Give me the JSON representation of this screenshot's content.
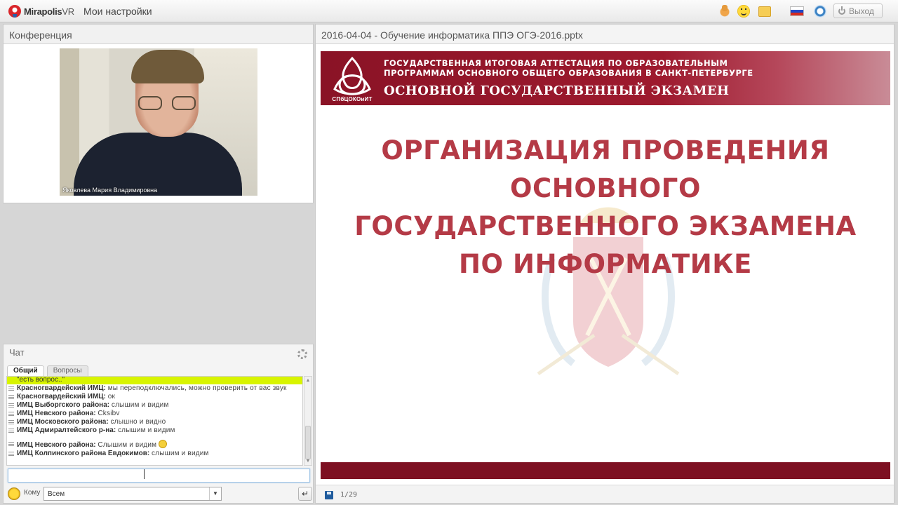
{
  "app": {
    "logo_main": "Mirapolis",
    "logo_suffix": "VR",
    "nav_settings": "Мои настройки",
    "exit_label": "Выход",
    "icons": [
      "hand-icon",
      "smile-icon",
      "folder-icon",
      "russian-flag-icon",
      "help-icon",
      "power-icon"
    ]
  },
  "conference": {
    "title": "Конференция",
    "participant_name": "Яковлева Мария Владимировна"
  },
  "presentation": {
    "file_title": "2016-04-04 - Обучение информатика ППЭ ОГЭ-2016.pptx",
    "page_indicator": "1/29",
    "slide": {
      "banner_line1": "ГОСУДАРСТВЕННАЯ ИТОГОВАЯ АТТЕСТАЦИЯ ПО ОБРАЗОВАТЕЛЬНЫМ",
      "banner_line2": "ПРОГРАММАМ ОСНОВНОГО ОБЩЕГО ОБРАЗОВАНИЯ В САНКТ-ПЕТЕРБУРГЕ",
      "banner_line3": "ОСНОВНОЙ ГОСУДАРСТВЕННЫЙ ЭКЗАМЕН",
      "emblem_label": "СПбЦОКОиИТ",
      "title_lines": [
        "ОРГАНИЗАЦИЯ ПРОВЕДЕНИЯ",
        "ОСНОВНОГО",
        "ГОСУДАРСТВЕННОГО ЭКЗАМЕНА",
        "ПО ИНФОРМАТИКЕ"
      ],
      "colors": {
        "banner": "#9e1a2e",
        "title": "#b43a46",
        "footer": "#7d1022"
      }
    }
  },
  "chat": {
    "title": "Чат",
    "tabs": [
      {
        "label": "Общий",
        "active": true
      },
      {
        "label": "Вопросы",
        "active": false
      }
    ],
    "highlight_text": "\"есть вопрос..\"",
    "messages": [
      {
        "who": "Красногвардейский ИМЦ:",
        "text": "мы переподключались, можно проверить от вас звук"
      },
      {
        "who": "Красногвардейский ИМЦ:",
        "text": "ок"
      },
      {
        "who": "ИМЦ Выборгского района:",
        "text": "слышим и видим"
      },
      {
        "who": "ИМЦ Невского района:",
        "text": "Cksibv"
      },
      {
        "who": "ИМЦ Московского района:",
        "text": " слышно и видно"
      },
      {
        "who": "ИМЦ Адмиралтейского р-на:",
        "text": "слышим и видим"
      },
      {
        "who": "ИМЦ Невского района:",
        "text": "Слышим и видим",
        "emoji": true
      },
      {
        "who": "ИМЦ Колпинского района Евдокимов:",
        "text": "слышим и видим"
      }
    ],
    "input_value": "",
    "to_label": "Кому",
    "to_selected": "Всем"
  }
}
